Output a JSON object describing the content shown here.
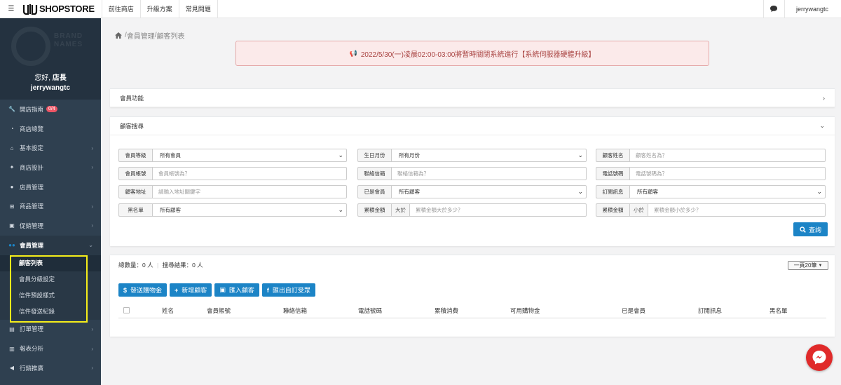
{
  "topbar": {
    "menu_icon": "hamburger-icon",
    "logo_text": "SHOPSTORE",
    "links": [
      "前往商店",
      "升級方案",
      "常見問題"
    ],
    "user": "jerrywangtc"
  },
  "sidebar": {
    "brand_text": [
      "BRAND",
      "NAMES"
    ],
    "greeting_prefix": "您好, ",
    "greeting_role": "店長",
    "username": "jerrywangtc",
    "items": [
      {
        "label": "開店指南",
        "icon": "wrench-icon",
        "badge": "0/4",
        "arrow": ""
      },
      {
        "label": "商店總覽",
        "icon": "dashboard-icon",
        "arrow": ""
      },
      {
        "label": "基本設定",
        "icon": "bank-icon",
        "arrow": "›"
      },
      {
        "label": "商店設計",
        "icon": "magic-icon",
        "arrow": "›"
      },
      {
        "label": "店員管理",
        "icon": "user-icon",
        "arrow": ""
      },
      {
        "label": "商品管理",
        "icon": "cart-icon",
        "arrow": "›"
      },
      {
        "label": "促銷管理",
        "icon": "gift-icon",
        "arrow": "›"
      },
      {
        "label": "會員管理",
        "icon": "users-icon",
        "arrow": "⌄"
      }
    ],
    "subitems": [
      "顧客列表",
      "會員分級設定",
      "信件預設樣式",
      "信件發送紀錄"
    ],
    "items_after": [
      {
        "label": "訂單管理",
        "icon": "file-icon",
        "arrow": "›"
      },
      {
        "label": "報表分析",
        "icon": "chart-icon",
        "arrow": "›"
      },
      {
        "label": "行銷推廣",
        "icon": "bullhorn-icon",
        "arrow": "›"
      }
    ]
  },
  "breadcrumb": {
    "sep": " / ",
    "items": [
      "會員管理",
      "顧客列表"
    ]
  },
  "notice": "2022/5/30(一)凌晨02:00-03:00將暫時關閉系統進行【系統伺服器硬體升級】",
  "panel_member": {
    "title": "會員功能"
  },
  "panel_search": {
    "title": "顧客搜尋",
    "fields": {
      "level": {
        "label": "會員等級",
        "value": "所有會員"
      },
      "birth": {
        "label": "生日月份",
        "value": "所有月份"
      },
      "name": {
        "label": "顧客姓名",
        "placeholder": "顧客姓名為？"
      },
      "account": {
        "label": "會員帳號",
        "placeholder": "會員帳號為？"
      },
      "email": {
        "label": "聯絡信箱",
        "placeholder": "聯絡信箱為？"
      },
      "phone": {
        "label": "電話號碼",
        "placeholder": "電話號碼為？"
      },
      "address": {
        "label": "顧客地址",
        "placeholder": "請輸入地址關鍵字"
      },
      "is_member": {
        "label": "已是會員",
        "value": "所有顧客"
      },
      "subscribe": {
        "label": "訂閱訊息",
        "value": "所有顧客"
      },
      "blacklist": {
        "label": "黑名單",
        "value": "所有顧客"
      },
      "total_gt": {
        "label": "累積金額",
        "prefix": "大於",
        "placeholder": "累積金額大於多少？"
      },
      "total_lt": {
        "label": "累積金額",
        "prefix": "小於",
        "placeholder": "累積金額小於多少？"
      }
    },
    "search_button": "查詢"
  },
  "results": {
    "total_label": "總數量：0 人",
    "found_label": "搜尋結果：0 人",
    "page_size": "一頁20筆",
    "buttons": [
      {
        "label": "發送購物金",
        "icon": "$"
      },
      {
        "label": "新增顧客",
        "icon": "+"
      },
      {
        "label": "匯入顧客",
        "icon": "▣"
      },
      {
        "label": "匯出自訂受眾",
        "icon": "f"
      }
    ],
    "columns": [
      "姓名",
      "會員帳號",
      "聯絡信箱",
      "電話號碼",
      "累積消費",
      "可用購物金",
      "已是會員",
      "訂閱訊息",
      "黑名單"
    ]
  },
  "colors": {
    "sidebar": "#2f4050",
    "primary": "#1c84c6",
    "highlight": "#f6ee1a",
    "notice_bg": "#fbeaea"
  },
  "messenger": {
    "icon": "messenger-icon"
  }
}
